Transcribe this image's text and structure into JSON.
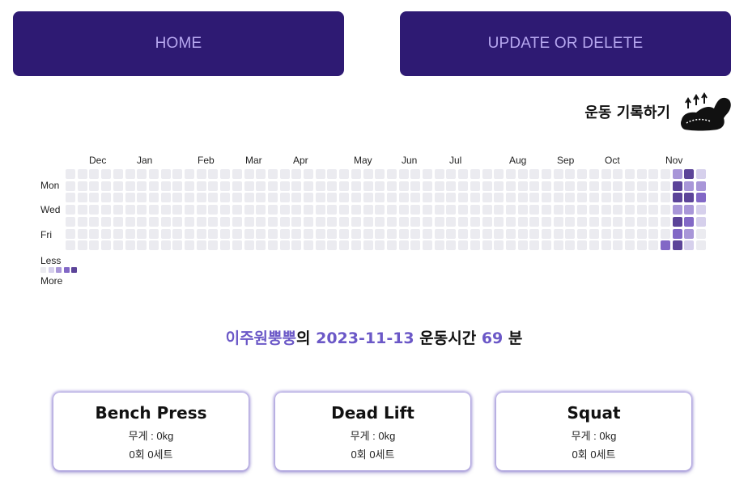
{
  "nav": {
    "home_label": "HOME",
    "update_label": "UPDATE OR DELETE"
  },
  "header": {
    "title": "운동 기록하기",
    "icon": "flexed-bicep-icon"
  },
  "heatmap": {
    "months": [
      "Dec",
      "Jan",
      "Feb",
      "Mar",
      "Apr",
      "May",
      "Jun",
      "Jul",
      "Aug",
      "Sep",
      "Oct",
      "Nov"
    ],
    "days": [
      "Mon",
      "Wed",
      "Fri"
    ],
    "legend_less": "Less",
    "legend_more": "More",
    "colors": [
      "#ebebf0",
      "#d6d0ec",
      "#a896d8",
      "#8268c6",
      "#5c4499"
    ],
    "active_cells": [
      {
        "week": 50,
        "day": 6,
        "level": 3
      },
      {
        "week": 51,
        "day": 0,
        "level": 2
      },
      {
        "week": 51,
        "day": 1,
        "level": 4
      },
      {
        "week": 51,
        "day": 2,
        "level": 4
      },
      {
        "week": 51,
        "day": 3,
        "level": 2
      },
      {
        "week": 51,
        "day": 4,
        "level": 4
      },
      {
        "week": 51,
        "day": 5,
        "level": 3
      },
      {
        "week": 51,
        "day": 6,
        "level": 4
      },
      {
        "week": 52,
        "day": 0,
        "level": 4
      },
      {
        "week": 52,
        "day": 1,
        "level": 2
      },
      {
        "week": 52,
        "day": 2,
        "level": 4
      },
      {
        "week": 52,
        "day": 3,
        "level": 2
      },
      {
        "week": 52,
        "day": 4,
        "level": 3
      },
      {
        "week": 52,
        "day": 5,
        "level": 2
      },
      {
        "week": 52,
        "day": 6,
        "level": 1
      },
      {
        "week": 53,
        "day": 0,
        "level": 1
      },
      {
        "week": 53,
        "day": 1,
        "level": 2
      },
      {
        "week": 53,
        "day": 2,
        "level": 3
      },
      {
        "week": 53,
        "day": 3,
        "level": 1
      },
      {
        "week": 53,
        "day": 4,
        "level": 1
      }
    ]
  },
  "summary": {
    "user": "이주원뿡뿡",
    "particle": "의",
    "date": "2023-11-13",
    "label": "운동시간",
    "minutes": "69",
    "unit": "분"
  },
  "exercises": [
    {
      "name": "Bench Press",
      "weight": "무게 : 0kg",
      "reps_sets": "0회 0세트"
    },
    {
      "name": "Dead Lift",
      "weight": "무게 : 0kg",
      "reps_sets": "0회 0세트"
    },
    {
      "name": "Squat",
      "weight": "무게 : 0kg",
      "reps_sets": "0회 0세트"
    }
  ]
}
